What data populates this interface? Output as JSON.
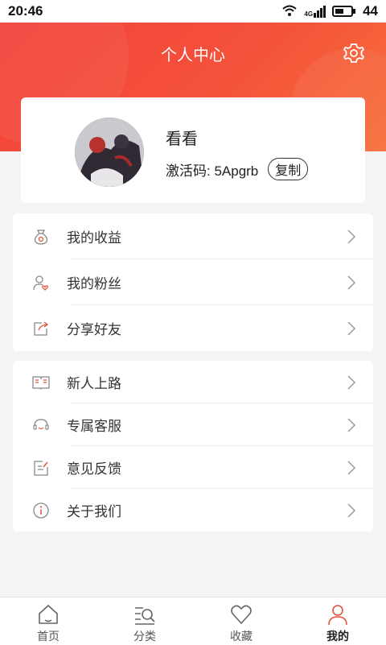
{
  "status_bar": {
    "time": "20:46",
    "network": "4G",
    "battery": "44"
  },
  "header": {
    "title": "个人中心"
  },
  "profile": {
    "nickname": "看看",
    "code_label": "激活码: 5Apgrb",
    "copy_label": "复制"
  },
  "menu_group_1": [
    {
      "label": "我的收益",
      "icon": "money-bag-icon"
    },
    {
      "label": "我的粉丝",
      "icon": "user-heart-icon"
    },
    {
      "label": "分享好友",
      "icon": "share-icon"
    }
  ],
  "menu_group_2": [
    {
      "label": "新人上路",
      "icon": "book-icon"
    },
    {
      "label": "专属客服",
      "icon": "customer-service-icon"
    },
    {
      "label": "意见反馈",
      "icon": "feedback-icon"
    },
    {
      "label": "关于我们",
      "icon": "info-icon"
    }
  ],
  "tabbar": [
    {
      "label": "首页",
      "icon": "home-icon",
      "active": false
    },
    {
      "label": "分类",
      "icon": "category-search-icon",
      "active": false
    },
    {
      "label": "收藏",
      "icon": "heart-icon",
      "active": false
    },
    {
      "label": "我的",
      "icon": "user-icon",
      "active": true
    }
  ],
  "colors": {
    "brand": "#f2403a",
    "accent_icon": "#e0533c",
    "background": "#f4f4f4"
  }
}
